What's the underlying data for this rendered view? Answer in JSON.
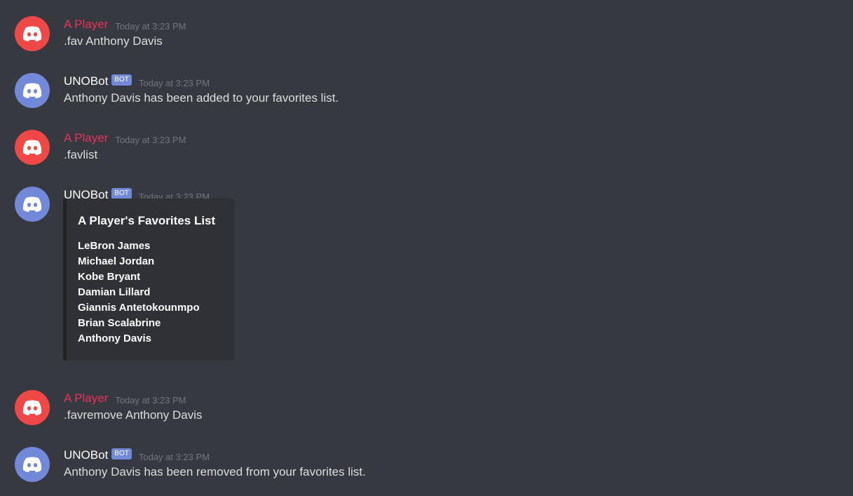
{
  "messages": [
    {
      "author": "A Player",
      "is_bot": false,
      "avatar_icon": "discord-logo-icon",
      "avatar_color": "#f04747",
      "timestamp": "Today at 3:23 PM",
      "text": ".fav Anthony Davis"
    },
    {
      "author": "UNOBot",
      "is_bot": true,
      "bot_tag": "BOT",
      "avatar_icon": "discord-logo-icon",
      "avatar_color": "#7289da",
      "timestamp": "Today at 3:23 PM",
      "text": "Anthony Davis has been added to your favorites list."
    },
    {
      "author": "A Player",
      "is_bot": false,
      "avatar_icon": "discord-logo-icon",
      "avatar_color": "#f04747",
      "timestamp": "Today at 3:23 PM",
      "text": ".favlist"
    },
    {
      "author": "UNOBot",
      "is_bot": true,
      "bot_tag": "BOT",
      "avatar_icon": "discord-logo-icon",
      "avatar_color": "#7289da",
      "timestamp": "Today at 3:23 PM",
      "embed": {
        "title": "A Player's Favorites List",
        "items": [
          "LeBron James",
          "Michael Jordan",
          "Kobe Bryant",
          "Damian Lillard",
          "Giannis Antetokounmpo",
          "Brian Scalabrine",
          "Anthony Davis"
        ]
      }
    },
    {
      "author": "A Player",
      "is_bot": false,
      "avatar_icon": "discord-logo-icon",
      "avatar_color": "#f04747",
      "timestamp": "Today at 3:23 PM",
      "text": ".favremove Anthony Davis"
    },
    {
      "author": "UNOBot",
      "is_bot": true,
      "bot_tag": "BOT",
      "avatar_icon": "discord-logo-icon",
      "avatar_color": "#7289da",
      "timestamp": "Today at 3:23 PM",
      "text": "Anthony Davis has been removed from your favorites list."
    }
  ],
  "colors": {
    "background": "#36393f",
    "user_name": "#e8305f",
    "bot_name": "#ffffff",
    "bot_tag": "#7289da",
    "timestamp": "#72767d",
    "message_text": "#dcddde",
    "embed_background": "#2f3136"
  }
}
